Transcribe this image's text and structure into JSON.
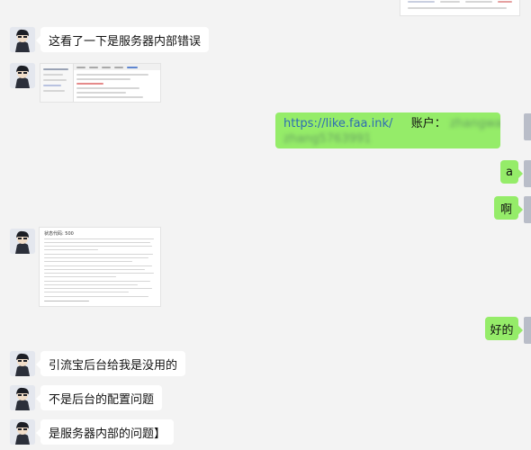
{
  "messages": {
    "m1": "这看了一下是服务器内部错误",
    "m2_link": "https://like.faa.ink/",
    "m2_account_label": "账户：",
    "m2_account_value": "zhangwangfu",
    "m2_account_value2": "zhang5763991",
    "m3": "a",
    "m4": "啊",
    "m5": "好的",
    "m6": "引流宝后台给我是没用的",
    "m7": "不是后台的配置问题",
    "m8": "是服务器内部的问题】"
  },
  "thumb2": {
    "status_title": "状态代码: 500"
  },
  "colors": {
    "background": "#f3f3f3",
    "incoming_bubble": "#ffffff",
    "outgoing_bubble": "#95ec69",
    "link": "#2e6cb3"
  }
}
